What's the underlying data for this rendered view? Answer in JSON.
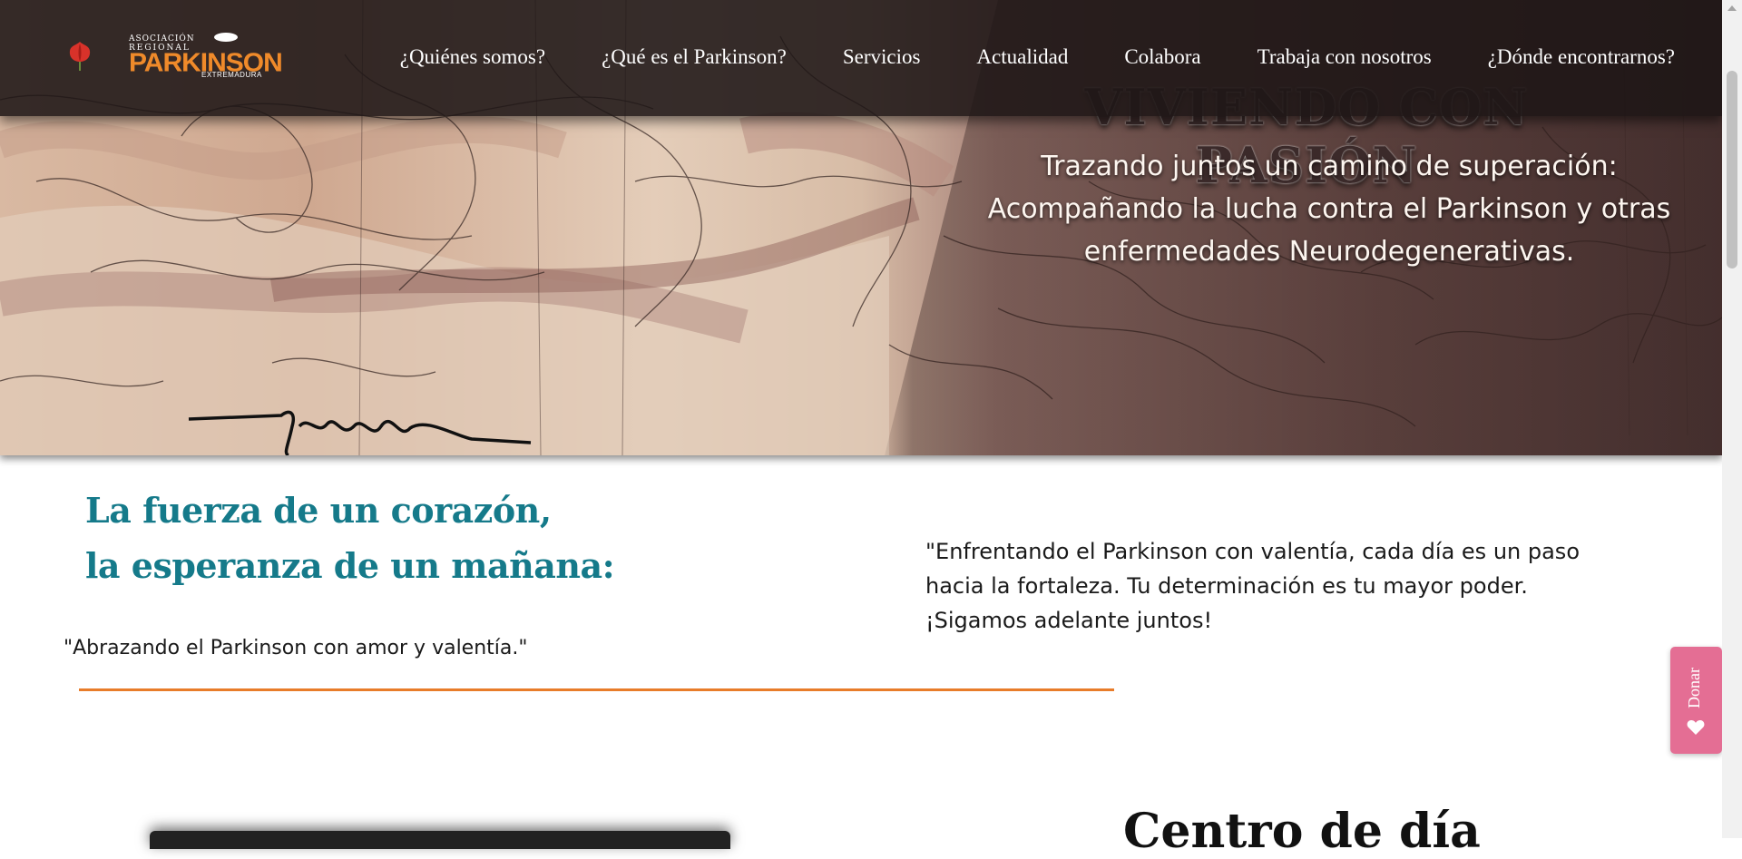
{
  "brand": {
    "line1": "ASOCIACIÓN",
    "line2": "REGIONAL",
    "name": "PARKINSON",
    "region": "EXTREMADURA"
  },
  "nav": {
    "items": [
      "¿Quiénes somos?",
      "¿Qué es el Parkinson?",
      "Servicios",
      "Actualidad",
      "Colabora",
      "Trabaja con nosotros",
      "¿Dónde encontrarnos?"
    ]
  },
  "hero": {
    "heading": "VIVIENDO CON PASIÓN",
    "subtitle_line1": "Trazando juntos un camino de superación:",
    "subtitle_line2": "Acompañando la lucha contra el Parkinson y otras",
    "subtitle_line3": "enfermedades Neurodegenerativas.",
    "signature": "Turner"
  },
  "intro": {
    "headline_line1": "La fuerza de un corazón,",
    "headline_line2": "la esperanza de un mañana:",
    "quote_left": "\"Abrazando el Parkinson con amor y valentía.\"",
    "quote_right": "\"Enfrentando el Parkinson con valentía, cada día es un paso hacia la fortaleza. Tu determinación es tu mayor poder. ¡Sigamos adelante juntos!"
  },
  "section": {
    "title": "Centro de día"
  },
  "donate": {
    "label": "Donar"
  },
  "colors": {
    "accent_teal": "#157a8a",
    "accent_orange": "#e87c2a",
    "donate_pink": "#e46e94",
    "header_bg": "#1e1616"
  },
  "icons": [
    "tulip-icon",
    "heart-icon"
  ]
}
